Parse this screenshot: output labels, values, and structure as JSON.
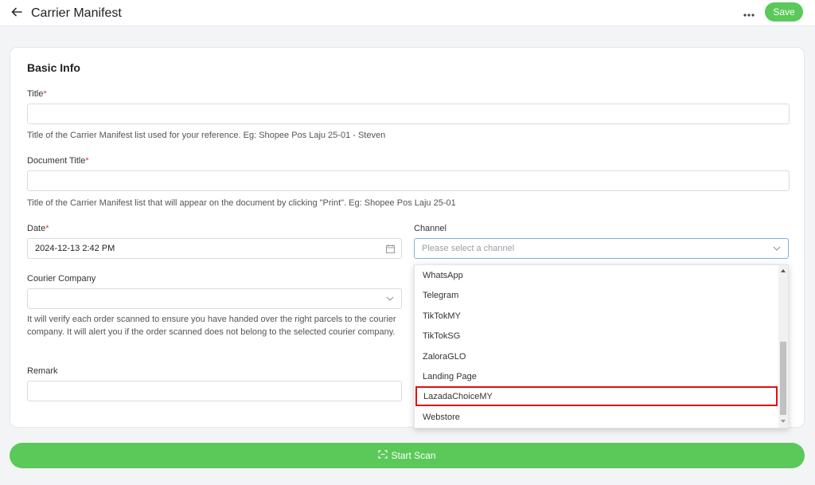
{
  "header": {
    "title": "Carrier Manifest",
    "save_label": "Save"
  },
  "basic_info": {
    "section_title": "Basic Info",
    "title_label": "Title",
    "title_value": "",
    "title_help": "Title of the Carrier Manifest list used for your reference. Eg: Shopee Pos Laju 25-01 - Steven",
    "doc_title_label": "Document Title",
    "doc_title_value": "",
    "doc_title_help": "Title of the Carrier Manifest list that will appear on the document by clicking \"Print\". Eg: Shopee Pos Laju 25-01",
    "date_label": "Date",
    "date_value": "2024-12-13 2:42 PM",
    "channel_label": "Channel",
    "channel_placeholder": "Please select a channel",
    "courier_label": "Courier Company",
    "courier_value": "",
    "courier_help": "It will verify each order scanned to ensure you have handed over the right parcels to the courier company. It will alert you if the order scanned does not belong to the selected courier company.",
    "remark_label": "Remark",
    "remark_value": "",
    "required_mark": "*"
  },
  "channel_dropdown": {
    "options": [
      "WhatsApp",
      "Telegram",
      "TikTokMY",
      "TikTokSG",
      "ZaloraGLO",
      "Landing Page",
      "LazadaChoiceMY",
      "Webstore"
    ],
    "highlighted": "LazadaChoiceMY"
  },
  "footer": {
    "scan_label": "Start Scan"
  },
  "colors": {
    "accent_green": "#5ac95a",
    "required_red": "#e53935",
    "highlight_red": "#e01010"
  },
  "icons": {
    "back": "arrow-left-icon",
    "more": "more-dots-icon",
    "calendar": "calendar-icon",
    "chevron": "chevron-down-icon",
    "scan": "scan-icon"
  }
}
